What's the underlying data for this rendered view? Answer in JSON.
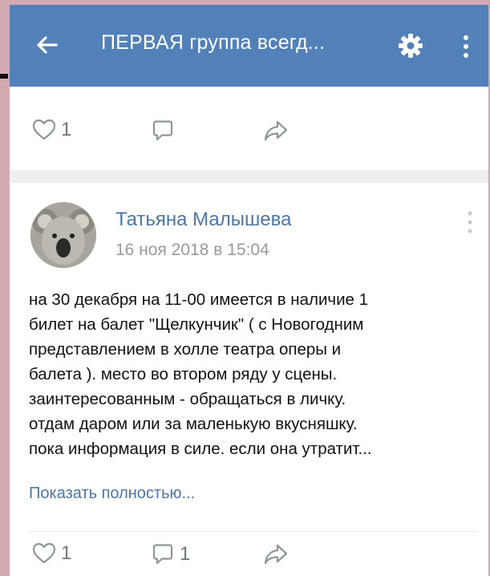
{
  "header": {
    "title": "ПЕРВАЯ группа всегд...",
    "back_icon": "arrow-left-icon",
    "settings_icon": "gear-icon",
    "more_icon": "more-vertical-icon",
    "bg_color": "#5181b8"
  },
  "prev_post_actions": {
    "likes": "1",
    "comments": "",
    "share_icon": "share-icon"
  },
  "post": {
    "author": "Татьяна Малышева",
    "date": "16 ноя 2018 в 15:04",
    "text_lines": [
      "на 30 декабря на 11-00 имеется в наличие 1",
      "билет на балет \"Щелкунчик\" ( с Новогодним",
      "представлением в холле театра оперы и",
      "балета ). место во втором ряду у сцены.",
      "заинтересованным - обращаться в личку.",
      "отдам даром или за маленькую вкусняшку.",
      "пока информация в силе. если она утратит..."
    ],
    "show_more": "Показать полностью...",
    "likes": "1",
    "comments": "1",
    "link_color": "#4a76a8"
  }
}
